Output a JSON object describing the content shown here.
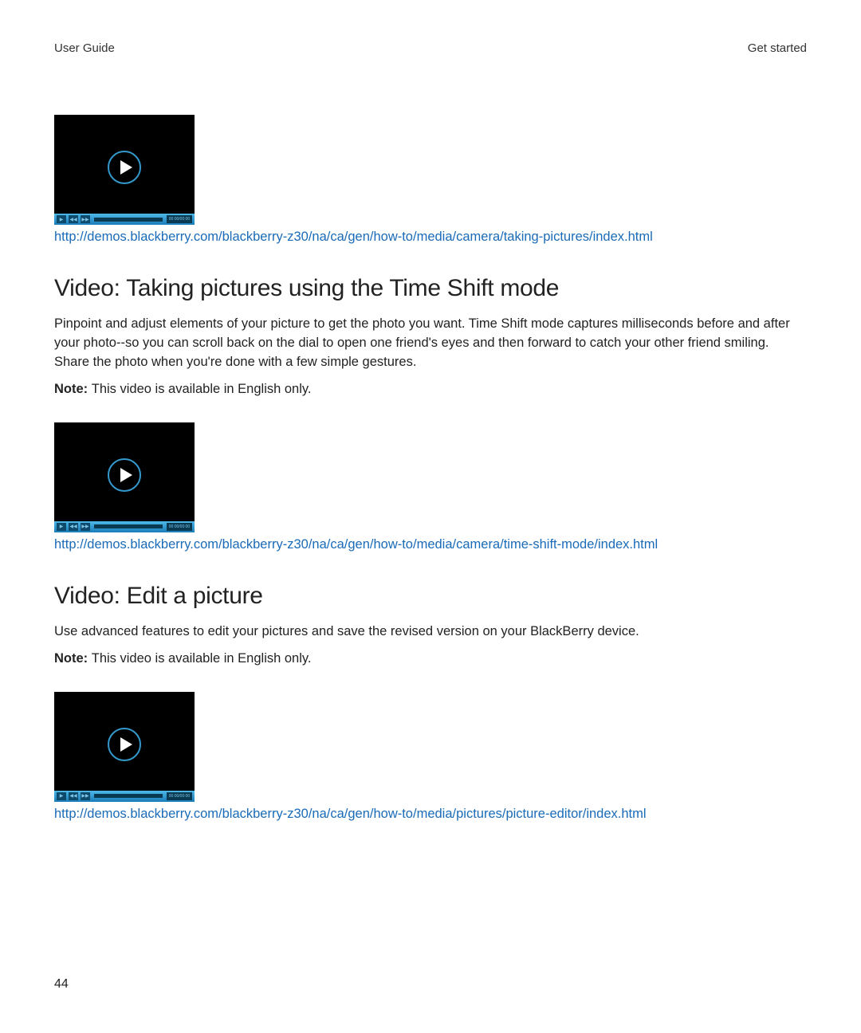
{
  "header": {
    "left": "User Guide",
    "right": "Get started"
  },
  "sections": [
    {
      "link_url": "http://demos.blackberry.com/blackberry-z30/na/ca/gen/how-to/media/camera/taking-pictures/index.html"
    },
    {
      "heading": "Video: Taking pictures using the Time Shift mode",
      "body": "Pinpoint and adjust elements of your picture to get the photo you want. Time Shift mode captures milliseconds before and after your photo--so you can scroll back on the dial to open one friend's eyes and then forward to catch your other friend smiling. Share the photo when you're done with a few simple gestures.",
      "note_label": "Note: ",
      "note_text": "This video is available in English only.",
      "link_url": "http://demos.blackberry.com/blackberry-z30/na/ca/gen/how-to/media/camera/time-shift-mode/index.html"
    },
    {
      "heading": "Video: Edit a picture",
      "body": "Use advanced features to edit your pictures and save the revised version on your BlackBerry device.",
      "note_label": "Note: ",
      "note_text": "This video is available in English only.",
      "link_url": "http://demos.blackberry.com/blackberry-z30/na/ca/gen/how-to/media/pictures/picture-editor/index.html"
    }
  ],
  "video_controls": {
    "time": "00:00/00:00"
  },
  "page_number": "44"
}
